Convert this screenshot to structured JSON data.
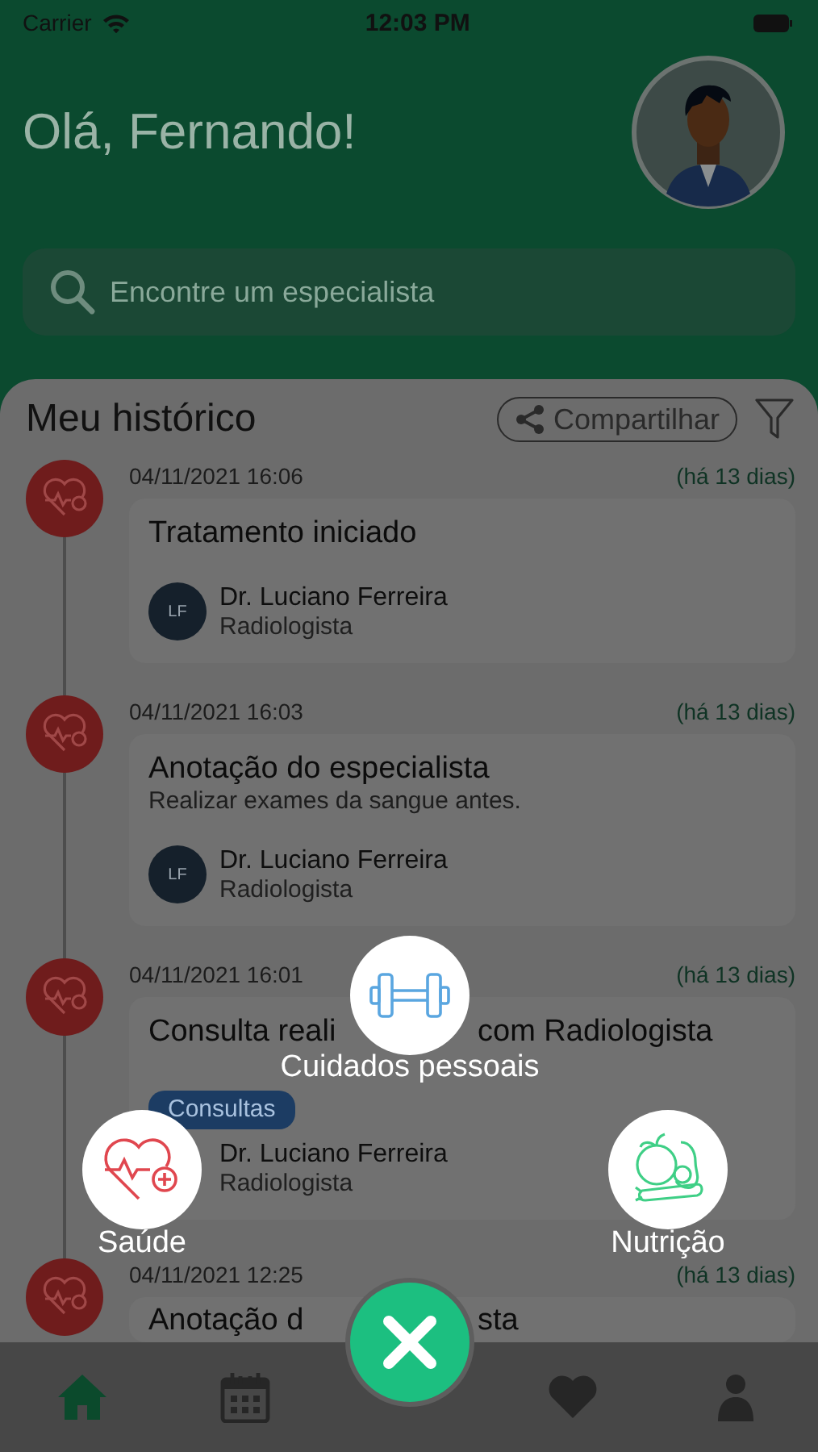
{
  "status_bar": {
    "carrier": "Carrier",
    "time": "12:03 PM"
  },
  "header": {
    "greeting": "Olá, Fernando!"
  },
  "search": {
    "placeholder": "Encontre um especialista"
  },
  "history": {
    "title": "Meu histórico",
    "share_button": "Compartilhar",
    "entries": [
      {
        "date": "04/11/2021 16:06",
        "ago": "(há 13 dias)",
        "title": "Tratamento iniciado",
        "doctor": {
          "initials": "LF",
          "name": "Dr. Luciano Ferreira",
          "specialty": "Radiologista"
        }
      },
      {
        "date": "04/11/2021 16:03",
        "ago": "(há 13 dias)",
        "title": "Anotação do especialista",
        "note": "Realizar exames da sangue antes.",
        "doctor": {
          "initials": "LF",
          "name": "Dr. Luciano Ferreira",
          "specialty": "Radiologista"
        }
      },
      {
        "date": "04/11/2021 16:01",
        "ago": "(há 13 dias)",
        "title_parts": [
          "Consulta reali",
          "com Radiologista"
        ],
        "tag": "Consultas",
        "doctor": {
          "name": "Dr. Luciano Ferreira",
          "specialty": "Radiologista"
        }
      },
      {
        "date": "04/11/2021 12:25",
        "ago": "(há 13 dias)",
        "title_parts": [
          "Anotação d",
          "sta"
        ]
      }
    ]
  },
  "quick_menu": {
    "items": [
      {
        "kind": "fitness",
        "label": "Cuidados pessoais"
      },
      {
        "kind": "health",
        "label": "Saúde"
      },
      {
        "kind": "nutrition",
        "label": "Nutrição"
      }
    ]
  },
  "tab_bar": {
    "tabs": [
      {
        "kind": "home",
        "selected": true
      },
      {
        "kind": "calendar",
        "selected": false
      },
      {
        "kind": "favorites",
        "selected": false
      },
      {
        "kind": "profile",
        "selected": false
      }
    ]
  }
}
